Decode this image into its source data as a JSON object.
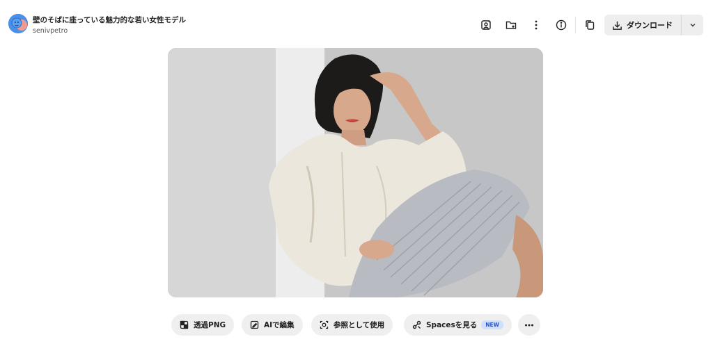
{
  "header": {
    "title": "壁のそばに座っている魅力的な若い女性モデル",
    "author": "senivpetro",
    "download_label": "ダウンロード"
  },
  "toolbar": {
    "icons": [
      "image-edit-icon",
      "folder-add-icon",
      "more-vertical-icon",
      "info-icon",
      "copy-icon"
    ]
  },
  "actions": {
    "png_label": "透過PNG",
    "ai_edit_label": "AIで編集",
    "reference_label": "参照として使用",
    "spaces_label": "Spacesを見る",
    "new_badge": "NEW"
  },
  "colors": {
    "pill_bg": "#efefef",
    "download_bg": "#eeeeee",
    "badge_bg": "#cfe0ff",
    "badge_text": "#2856c8",
    "avatar_blue": "#4a8fe8",
    "avatar_pink": "#f39a8f"
  }
}
